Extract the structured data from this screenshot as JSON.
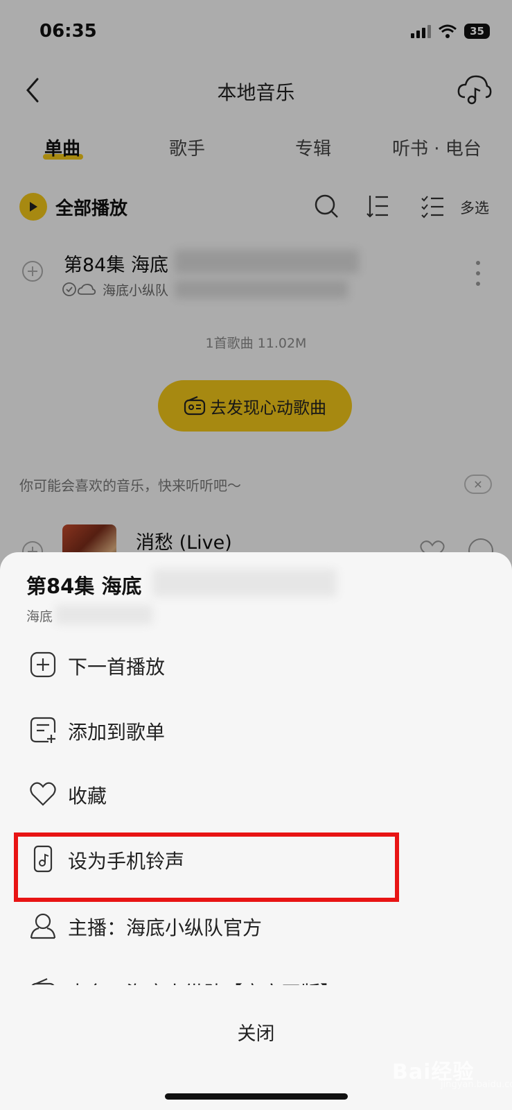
{
  "status_bar": {
    "time": "06:35",
    "battery": "35"
  },
  "header": {
    "title": "本地音乐"
  },
  "tabs": [
    {
      "label": "单曲",
      "active": true
    },
    {
      "label": "歌手"
    },
    {
      "label": "专辑"
    },
    {
      "label": "听书 · 电台"
    }
  ],
  "toolbar": {
    "play_all": "全部播放",
    "multi_select": "多选"
  },
  "song": {
    "title": "第84集 海底",
    "subtitle": "海底小纵队"
  },
  "summary": "1首歌曲 11.02M",
  "discover_button": "去发现心动歌曲",
  "recommend": {
    "text": "你可能会喜欢的音乐，快来听听吧～",
    "song_title": "消愁 (Live)"
  },
  "sheet": {
    "title": "第84集 海底",
    "subtitle": "海底",
    "items": [
      {
        "label": "下一首播放",
        "icon": "add-square-icon"
      },
      {
        "label": "添加到歌单",
        "icon": "playlist-add-icon"
      },
      {
        "label": "收藏",
        "icon": "heart-icon"
      },
      {
        "label": "设为手机铃声",
        "icon": "phone-ringtone-icon"
      },
      {
        "label": "主播：海底小纵队官方",
        "icon": "person-icon"
      },
      {
        "label": "电台：海底小纵队【官方正版】",
        "icon": "radio-icon"
      }
    ],
    "close": "关闭"
  },
  "watermark": {
    "brand": "Bai经验",
    "url": "jingyan.baidu.com"
  },
  "colors": {
    "accent": "#f0c419",
    "highlight": "#e81414"
  }
}
